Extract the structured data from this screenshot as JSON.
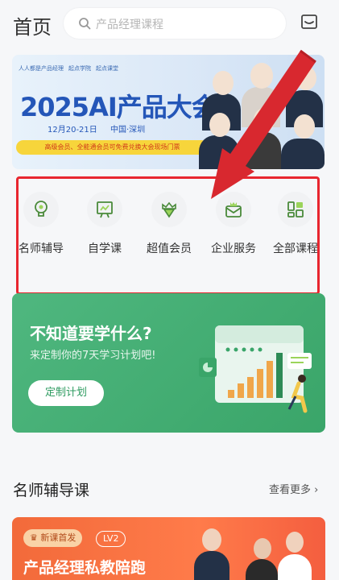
{
  "header": {
    "title": "首页",
    "search_placeholder": "产品经理课程"
  },
  "banner": {
    "logos": [
      "人人都是产品经理",
      "起点学院",
      "起点课堂"
    ],
    "title": "2025AI产品大会",
    "date": "12月20-21日",
    "location": "中国·深圳",
    "strip": "高级会员、全能通会员可免费兑换大会现场门票"
  },
  "menu": {
    "items": [
      {
        "label": "名师辅导",
        "icon": "bulb-icon"
      },
      {
        "label": "自学课",
        "icon": "presentation-icon"
      },
      {
        "label": "超值会员",
        "icon": "crown-badge-icon"
      },
      {
        "label": "企业服务",
        "icon": "mail-crown-icon"
      },
      {
        "label": "全部课程",
        "icon": "grid-icon"
      }
    ]
  },
  "promo": {
    "title": "不知道要学什么?",
    "subtitle": "来定制你的7天学习计划吧!",
    "button": "定制计划"
  },
  "section": {
    "title": "名师辅导课",
    "more": "查看更多"
  },
  "course": {
    "tag": "新课首发",
    "level": "LV2",
    "title": "产品经理私教陪跑"
  },
  "colors": {
    "accent_blue": "#2456b8",
    "highlight_red": "#e8262f",
    "promo_green": "#4fb77f",
    "course_orange": "#f26a3a"
  }
}
